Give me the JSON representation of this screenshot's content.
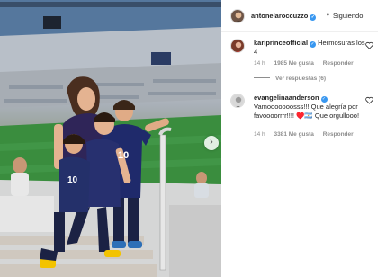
{
  "post": {
    "author": "antonelaroccuzzo",
    "follow_status": "Siguiendo",
    "separator": "•"
  },
  "comments": [
    {
      "user": "kariprinceofficial",
      "text": "Hermosuras los 4",
      "age": "14 h",
      "likes": "1985 Me gusta",
      "reply": "Responder",
      "view_replies": "Ver respuestas (6)"
    },
    {
      "user": "evangelinaanderson",
      "text": "Vamooooooosss!!! Que alegría por favoooorrrr!!!! ♥️🇦🇷 Que orgullooo!",
      "age": "14 h",
      "likes": "3381 Me gusta",
      "reply": "Responder"
    }
  ],
  "photo": {
    "shirt_number": "10",
    "icons": [
      "chevron-right-icon",
      "heart-icon",
      "verified-icon"
    ]
  },
  "colors": {
    "verified": "#3897f0",
    "muted_text": "#8e8e8e",
    "pitch_green": "#35813a",
    "argentina_navy": "#1f2a6b"
  }
}
